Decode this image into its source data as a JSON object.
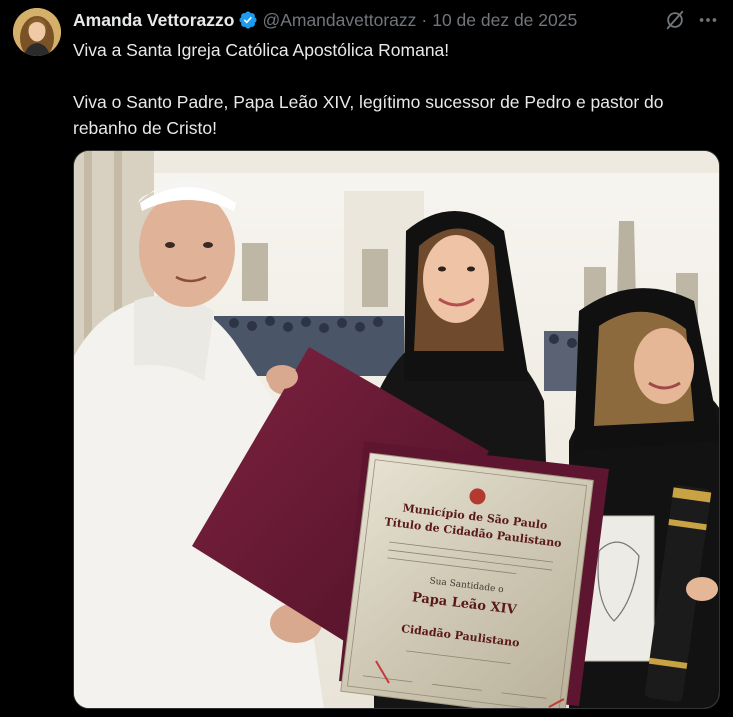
{
  "author": {
    "display_name": "Amanda Vettorazzo",
    "handle": "@Amandavettorazz",
    "verified_icon": "verified-badge-icon"
  },
  "post": {
    "separator": "·",
    "date": "10 de dez de 2025",
    "paragraphs": [
      "Viva a Santa Igreja Católica Apostólica Romana!",
      "Viva o Santo Padre, Papa Leão XIV, legítimo sucessor de Pedro e pastor do rebanho de Cristo!"
    ]
  },
  "actions": {
    "grok_icon": "grok-icon",
    "more_icon": "more-options-icon"
  },
  "media": {
    "certificate": {
      "line1": "Município de São Paulo",
      "line2": "Título de Cidadão Paulistano",
      "line3": "Sua Santidade o",
      "line4": "Papa Leão XIV",
      "line5": "Cidadão Paulistano"
    }
  },
  "colors": {
    "background": "#000000",
    "text_primary": "#e7e9ea",
    "text_secondary": "#71767b",
    "verified_blue": "#1d9bf0",
    "folder_burgundy": "#6e1a35"
  }
}
